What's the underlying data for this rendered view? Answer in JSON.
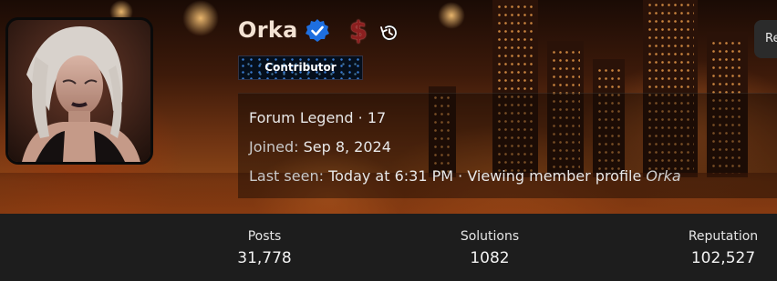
{
  "profile": {
    "username": "Orka",
    "role_badge": "Contributor",
    "info": {
      "title": "Forum Legend · 17",
      "joined_label": "Joined:",
      "joined_value": "Sep 8, 2024",
      "last_seen_label": "Last seen:",
      "last_seen_value": "Today at 6:31 PM · Viewing member profile",
      "last_seen_user": "Orka"
    },
    "icons": [
      "verified-badge-icon",
      "dollar-icon",
      "history-icon"
    ],
    "report_button_label": "Re"
  },
  "stats": [
    {
      "label": "Posts",
      "value": "31,778"
    },
    {
      "label": "Solutions",
      "value": "1082"
    },
    {
      "label": "Reputation",
      "value": "102,527"
    }
  ],
  "colors": {
    "verified_blue": "#1e6fe0",
    "dollar_red": "#8b1f1f",
    "stats_bg": "#1d1d1d"
  }
}
